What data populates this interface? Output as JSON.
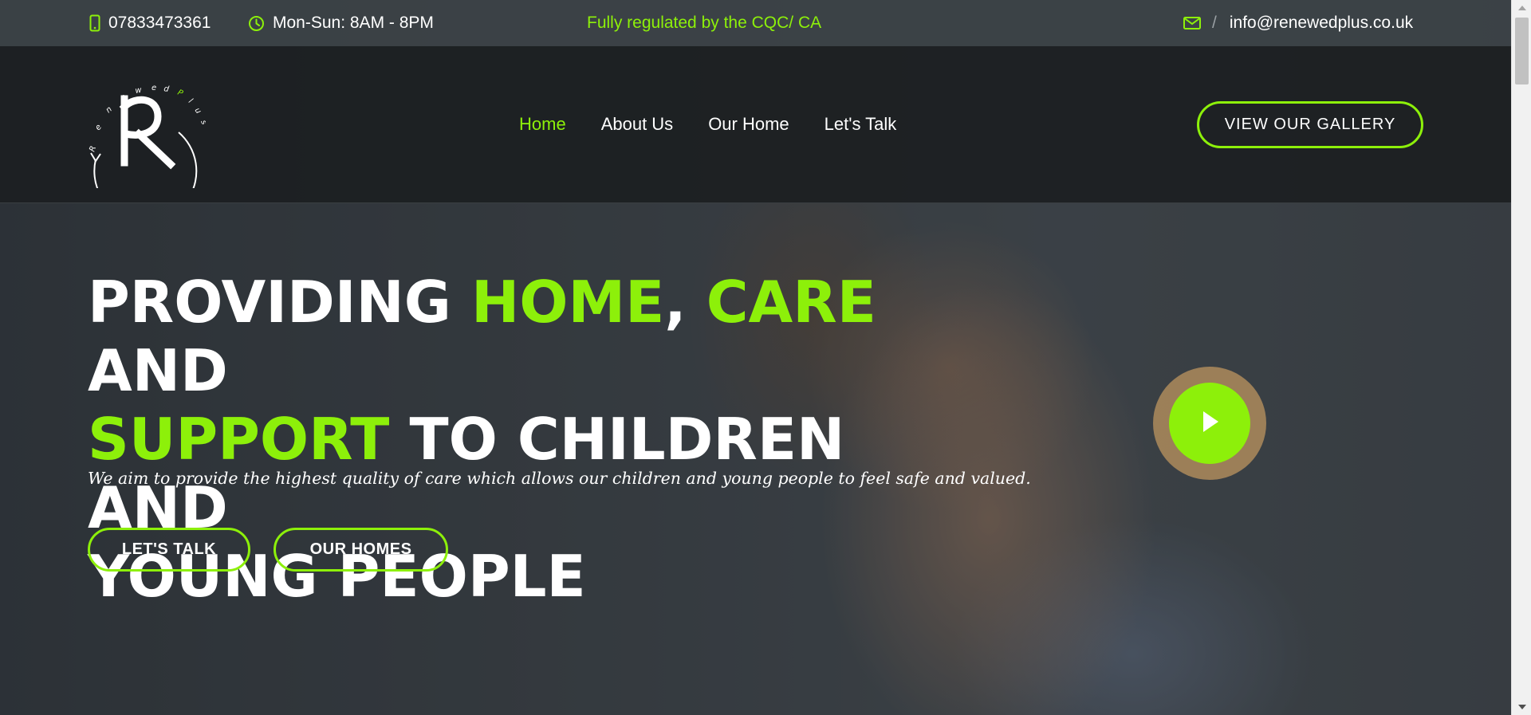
{
  "topbar": {
    "phone": "07833473361",
    "hours": "Mon-Sun: 8AM - 8PM",
    "regulated": "Fully regulated by the CQC/ CA",
    "separator": "/",
    "email": "info@renewedplus.co.uk",
    "icons": [
      "phone-icon",
      "clock-icon",
      "mail-icon"
    ]
  },
  "logo": {
    "text": "RenewedPlus",
    "monogram": "R"
  },
  "nav": {
    "items": [
      {
        "label": "Home",
        "active": true
      },
      {
        "label": "About Us",
        "active": false
      },
      {
        "label": "Our Home",
        "active": false
      },
      {
        "label": "Let's Talk",
        "active": false
      }
    ],
    "cta_label": "VIEW OUR GALLERY"
  },
  "hero": {
    "headline": {
      "w1": "PROVIDING",
      "w2": "HOME",
      "w3": ",",
      "w4": "CARE",
      "w5": "AND",
      "w6": "SUPPORT",
      "w7": "TO CHILDREN AND",
      "w8": "YOUNG PEOPLE"
    },
    "tagline": "We aim to provide the highest quality of care which allows our children and young people to feel safe and valued.",
    "buttons": {
      "talk": "LET'S TALK",
      "homes": "OUR HOMES"
    },
    "play_icon": "play-icon"
  },
  "colors": {
    "accent": "#8df00a",
    "header_bg": "#1c1f21",
    "topbar_bg": "#3c4246",
    "text": "#ffffff"
  }
}
